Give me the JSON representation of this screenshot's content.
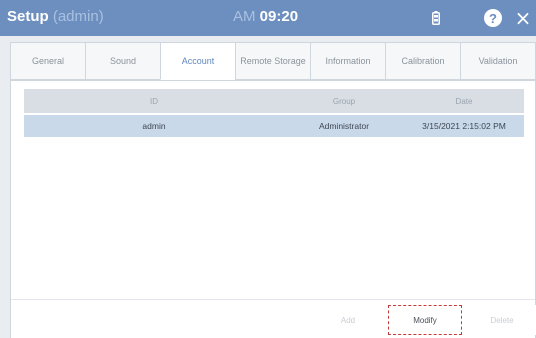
{
  "titlebar": {
    "title": "Setup",
    "user": "(admin)",
    "ampm": "AM",
    "time": "09:20",
    "icons": [
      "battery-icon",
      "help-icon",
      "close-icon"
    ],
    "close_glyph": "×",
    "help_glyph": "?"
  },
  "tabs": [
    {
      "label": "General",
      "active": false
    },
    {
      "label": "Sound",
      "active": false
    },
    {
      "label": "Account",
      "active": true
    },
    {
      "label": "Remote Storage",
      "active": false
    },
    {
      "label": "Information",
      "active": false
    },
    {
      "label": "Calibration",
      "active": false
    },
    {
      "label": "Validation",
      "active": false
    }
  ],
  "table": {
    "headers": {
      "id": "ID",
      "group": "Group",
      "date": "Date"
    },
    "rows": [
      {
        "id": "admin",
        "group": "Administrator",
        "date": "3/15/2021 2:15:02 PM"
      }
    ]
  },
  "buttons": {
    "add": "Add",
    "modify": "Modify",
    "delete": "Delete"
  },
  "colors": {
    "titlebar": "#6d8fbf",
    "selected_row": "#c9d9ea",
    "highlight_border": "#c83a3a"
  }
}
